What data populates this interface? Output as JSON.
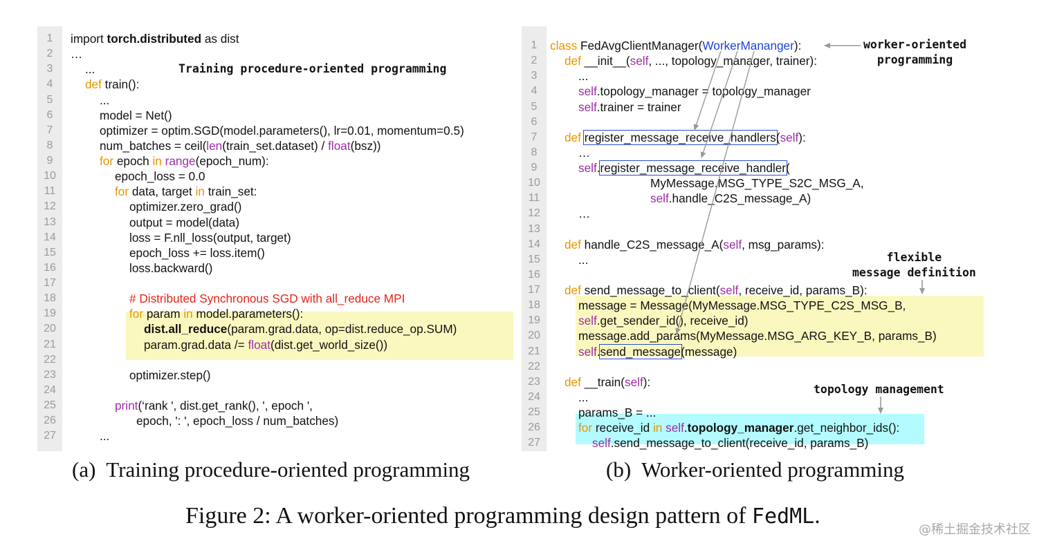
{
  "panel_a": {
    "line_numbers": [
      "1",
      "2",
      "3",
      "4",
      "5",
      "6",
      "7",
      "8",
      "9",
      "10",
      "11",
      "12",
      "13",
      "14",
      "15",
      "16",
      "17",
      "18",
      "19",
      "20",
      "21",
      "22",
      "23",
      "24",
      "25",
      "26",
      "27"
    ],
    "title_annotation": "Training procedure-oriented programming",
    "code": {
      "l1a": "import ",
      "l1b": "torch.distributed",
      "l1c": " as dist",
      "l2": "…",
      "l3": "...",
      "l4a": "def",
      "l4b": " train():",
      "l5": "...",
      "l6": "model = Net()",
      "l7": "optimizer = optim.SGD(model.parameters(), lr=0.01, momentum=0.5)",
      "l8a": "num_batches = ceil(",
      "l8b": "len",
      "l8c": "(train_set.dataset) / ",
      "l8d": "float",
      "l8e": "(bsz))",
      "l9a": "for",
      "l9b": " epoch ",
      "l9c": "in",
      "l9d": " ",
      "l9e": "range",
      "l9f": "(epoch_num):",
      "l10": "epoch_loss = 0.0",
      "l11a": "for",
      "l11b": " data, target ",
      "l11c": "in",
      "l11d": " train_set:",
      "l12": "optimizer.zero_grad()",
      "l13": "output = model(data)",
      "l14": "loss = F.nll_loss(output, target)",
      "l15": "epoch_loss += loss.item()",
      "l16": "loss.backward()",
      "l18": "# Distributed Synchronous SGD with all_reduce MPI",
      "l19a": "for",
      "l19b": " param ",
      "l19c": "in",
      "l19d": " model.parameters():",
      "l20a": "dist.all_reduce",
      "l20b": "(param.grad.data, op=dist.reduce_op.SUM)",
      "l21a": "param.grad.data /= ",
      "l21b": "float",
      "l21c": "(dist.get_world_size())",
      "l23": "optimizer.step()",
      "l25a": "print",
      "l25b": "(‘rank ', dist.get_rank(), ', epoch ',",
      "l26": "epoch, ': ', epoch_loss / num_batches)",
      "l27": "..."
    }
  },
  "panel_b": {
    "line_numbers": [
      "1",
      "2",
      "3",
      "4",
      "5",
      "6",
      "7",
      "8",
      "9",
      "10",
      "11",
      "12",
      "13",
      "14",
      "15",
      "16",
      "17",
      "18",
      "19",
      "20",
      "21",
      "22",
      "23",
      "24",
      "25",
      "26",
      "27"
    ],
    "annotations": {
      "worker": "worker-oriented\nprogramming",
      "message": "flexible\nmessage definition",
      "topology": "topology management"
    },
    "code": {
      "l1a": "class",
      "l1b": " FedAvgClientManager(",
      "l1c": "WorkerMananger",
      "l1d": "):",
      "l2a": "def",
      "l2b": " __init__(",
      "l2c": "self",
      "l2d": ", ..., topology_manager, trainer):",
      "l3": "...",
      "l4a": "self",
      "l4b": ".topology_manager = topology_manager",
      "l5a": "self",
      "l5b": ".trainer = trainer",
      "l7a": "def",
      "l7b": " ",
      "l7c": "register_message_receive_handlers",
      "l7d": "(",
      "l7e": "self",
      "l7f": "):",
      "l8": "…",
      "l9a": "self",
      "l9b": ".",
      "l9c": "register_message_receive_handler",
      "l9d": "(",
      "l10": "MyMessage.MSG_TYPE_S2C_MSG_A,",
      "l11a": "self",
      "l11b": ".handle_C2S_message_A)",
      "l12": "…",
      "l14a": "def",
      "l14b": " handle_C2S_message_A(",
      "l14c": "self",
      "l14d": ", msg_params):",
      "l15": "...",
      "l17a": "def",
      "l17b": " send_message_to_client(",
      "l17c": "self",
      "l17d": ", receive_id, params_B):",
      "l18": "message = Message(MyMessage.MSG_TYPE_C2S_MSG_B,",
      "l19a": "self",
      "l19b": ".get_sender_id(), receive_id)",
      "l20": "message.add_params(MyMessage.MSG_ARG_KEY_B, params_B)",
      "l21a": "self",
      "l21b": ".",
      "l21c": "send_message",
      "l21d": "(message)",
      "l23a": "def",
      "l23b": " __train(",
      "l23c": "self",
      "l23d": "):",
      "l24": "...",
      "l25": "params_B = ...",
      "l26a": "for",
      "l26b": " receive_id ",
      "l26c": "in",
      "l26d": " ",
      "l26e": "self",
      "l26f": ".",
      "l26g": "topology_manager",
      "l26h": ".get_neighbor_ids():",
      "l27a": "self",
      "l27b": ".send_message_to_client(receive_id, params_B)"
    }
  },
  "captions": {
    "a": "(a)  Training procedure-oriented programming",
    "b": "(b)  Worker-oriented programming",
    "figure_prefix": "Figure 2: A worker-oriented programming design pattern of ",
    "figure_code": "FedML",
    "figure_suffix": "."
  },
  "watermark": "@稀土掘金技术社区",
  "colors": {
    "keyword": "#e69500",
    "builtin": "#9b2fa6",
    "class_name": "#1d44d8",
    "comment": "#e5241b",
    "highlight_yellow": "#fbf8bf",
    "highlight_cyan": "#b3fbff",
    "box_border": "#2a4fc4",
    "arrow": "#999999"
  }
}
